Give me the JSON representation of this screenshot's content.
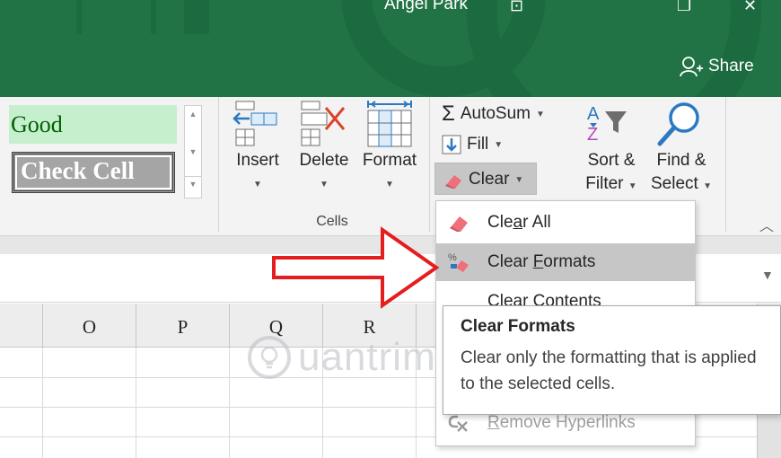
{
  "titlebar": {
    "title": "Angel Park",
    "share_label": "Share",
    "ribbon_display_glyph": "⊡",
    "restore_glyph": "❐",
    "close_glyph": "✕",
    "color": "#217346"
  },
  "ribbon": {
    "styles": {
      "good_label": "Good",
      "check_cell_label": "Check Cell"
    },
    "cells_group": {
      "label": "Cells",
      "insert_label": "Insert",
      "delete_label": "Delete",
      "format_label": "Format"
    },
    "editing_group": {
      "autosum_label": "AutoSum",
      "fill_label": "Fill",
      "clear_label": "Clear",
      "sort_filter_label_1": "Sort &",
      "sort_filter_label_2": "Filter",
      "find_select_label_1": "Find &",
      "find_select_label_2": "Select",
      "sort_icon_letters": "A Z"
    }
  },
  "columns": [
    "O",
    "P",
    "Q",
    "R"
  ],
  "clear_menu": {
    "items": [
      {
        "label_pre": "Cle",
        "label_u": "a",
        "label_post": "r All",
        "icon": "eraser-icon",
        "highlighted": false,
        "enabled": true
      },
      {
        "label_pre": "Clear ",
        "label_u": "F",
        "label_post": "ormats",
        "icon": "clear-formats-icon",
        "highlighted": true,
        "enabled": true
      },
      {
        "label_pre": "Clear Contents",
        "label_u": "",
        "label_post": "",
        "icon": "",
        "highlighted": false,
        "enabled": true
      },
      {
        "label_pre": "",
        "label_u": "R",
        "label_post": "emove Hyperlinks",
        "icon": "remove-hyperlink-icon",
        "highlighted": false,
        "enabled": false
      }
    ]
  },
  "tooltip": {
    "title": "Clear Formats",
    "body": "Clear only the formatting that is applied to the selected cells."
  },
  "watermark": {
    "text": "uantrimang"
  },
  "colors": {
    "ribbon_bg": "#f3f3f3",
    "highlight": "#c6c6c6",
    "good_fill": "#c6efce",
    "good_text": "#006100",
    "check_cell_fill": "#a5a5a5",
    "annotation_arrow": "#e41e1e"
  }
}
